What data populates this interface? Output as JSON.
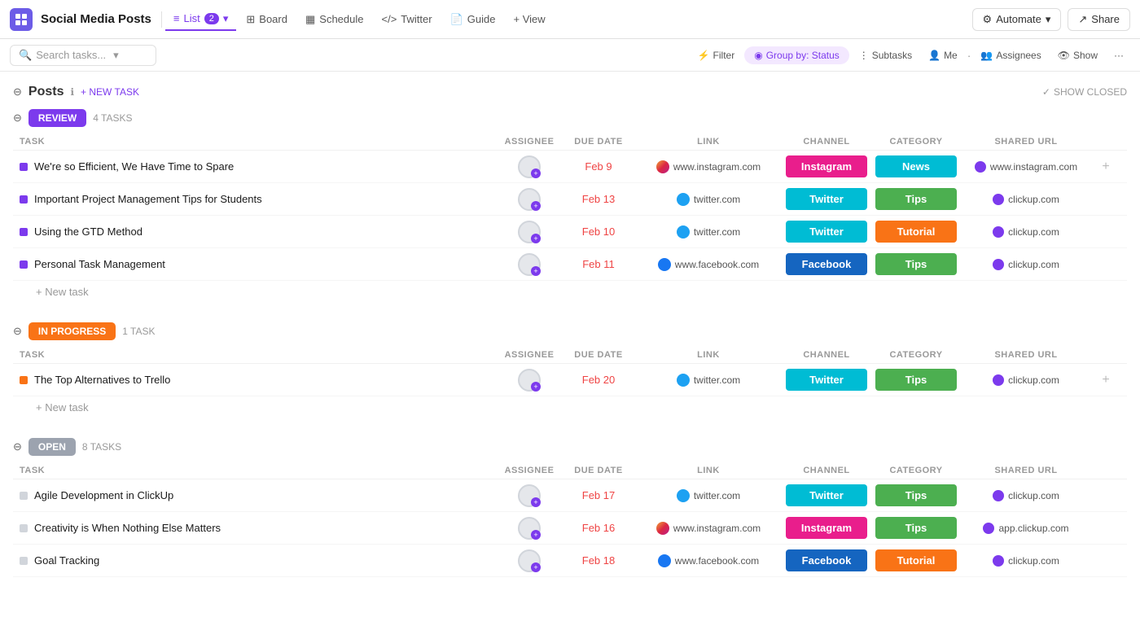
{
  "app": {
    "icon": "grid",
    "title": "Social Media Posts"
  },
  "nav": {
    "tabs": [
      {
        "id": "list",
        "label": "List",
        "badge": "2",
        "active": true,
        "icon": "≡"
      },
      {
        "id": "board",
        "label": "Board",
        "active": false,
        "icon": "⊞"
      },
      {
        "id": "schedule",
        "label": "Schedule",
        "active": false,
        "icon": "📅"
      },
      {
        "id": "twitter",
        "label": "Twitter",
        "active": false,
        "icon": "</>"
      },
      {
        "id": "guide",
        "label": "Guide",
        "active": false,
        "icon": "📄"
      }
    ],
    "view_btn": "+ View",
    "automate_btn": "Automate",
    "share_btn": "Share"
  },
  "toolbar": {
    "search_placeholder": "Search tasks...",
    "filter_label": "Filter",
    "group_by_label": "Group by: Status",
    "subtasks_label": "Subtasks",
    "me_label": "Me",
    "assignees_label": "Assignees",
    "show_label": "Show"
  },
  "posts_section": {
    "title": "Posts",
    "new_task_label": "+ NEW TASK",
    "show_closed_label": "SHOW CLOSED"
  },
  "col_headers": {
    "task": "TASK",
    "assignee": "ASSIGNEE",
    "due_date": "DUE DATE",
    "link": "LINK",
    "channel": "CHANNEL",
    "category": "CATEGORY",
    "shared_url": "SHARED URL"
  },
  "groups": [
    {
      "id": "review",
      "label": "REVIEW",
      "color_class": "review",
      "task_count": "4 TASKS",
      "tasks": [
        {
          "name": "We're so Efficient, We Have Time to Spare",
          "dot_class": "purple",
          "due_date": "Feb 9",
          "link_icon": "instagram",
          "link_text": "www.instagram.com",
          "channel": "Instagram",
          "channel_class": "instagram-ch",
          "category": "News",
          "category_class": "news",
          "shared_url": "www.instagram.com",
          "shared_icon_class": "clickup"
        },
        {
          "name": "Important Project Management Tips for Students",
          "dot_class": "purple",
          "due_date": "Feb 13",
          "link_icon": "twitter",
          "link_text": "twitter.com",
          "channel": "Twitter",
          "channel_class": "twitter-ch",
          "category": "Tips",
          "category_class": "tips",
          "shared_url": "clickup.com",
          "shared_icon_class": "clickup"
        },
        {
          "name": "Using the GTD Method",
          "dot_class": "purple",
          "due_date": "Feb 10",
          "link_icon": "twitter",
          "link_text": "twitter.com",
          "channel": "Twitter",
          "channel_class": "twitter-ch",
          "category": "Tutorial",
          "category_class": "tutorial",
          "shared_url": "clickup.com",
          "shared_icon_class": "clickup"
        },
        {
          "name": "Personal Task Management",
          "dot_class": "purple",
          "due_date": "Feb 11",
          "link_icon": "facebook",
          "link_text": "www.facebook.com",
          "channel": "Facebook",
          "channel_class": "facebook-ch",
          "category": "Tips",
          "category_class": "tips",
          "shared_url": "clickup.com",
          "shared_icon_class": "clickup"
        }
      ]
    },
    {
      "id": "in-progress",
      "label": "IN PROGRESS",
      "color_class": "in-progress",
      "task_count": "1 TASK",
      "tasks": [
        {
          "name": "The Top Alternatives to Trello",
          "dot_class": "orange",
          "due_date": "Feb 20",
          "link_icon": "twitter",
          "link_text": "twitter.com",
          "channel": "Twitter",
          "channel_class": "twitter-ch",
          "category": "Tips",
          "category_class": "tips",
          "shared_url": "clickup.com",
          "shared_icon_class": "clickup"
        }
      ]
    },
    {
      "id": "open",
      "label": "OPEN",
      "color_class": "open",
      "task_count": "8 TASKS",
      "tasks": [
        {
          "name": "Agile Development in ClickUp",
          "dot_class": "gray",
          "due_date": "Feb 17",
          "link_icon": "twitter",
          "link_text": "twitter.com",
          "channel": "Twitter",
          "channel_class": "twitter-ch",
          "category": "Tips",
          "category_class": "tips",
          "shared_url": "clickup.com",
          "shared_icon_class": "clickup"
        },
        {
          "name": "Creativity is When Nothing Else Matters",
          "dot_class": "gray",
          "due_date": "Feb 16",
          "link_icon": "instagram",
          "link_text": "www.instagram.com",
          "channel": "Instagram",
          "channel_class": "instagram-ch",
          "category": "Tips",
          "category_class": "tips",
          "shared_url": "app.clickup.com",
          "shared_icon_class": "clickup"
        },
        {
          "name": "Goal Tracking",
          "dot_class": "gray",
          "due_date": "Feb 18",
          "link_icon": "facebook",
          "link_text": "www.facebook.com",
          "channel": "Facebook",
          "channel_class": "facebook-ch",
          "category": "Tutorial",
          "category_class": "tutorial",
          "shared_url": "clickup.com",
          "shared_icon_class": "clickup"
        }
      ]
    }
  ]
}
